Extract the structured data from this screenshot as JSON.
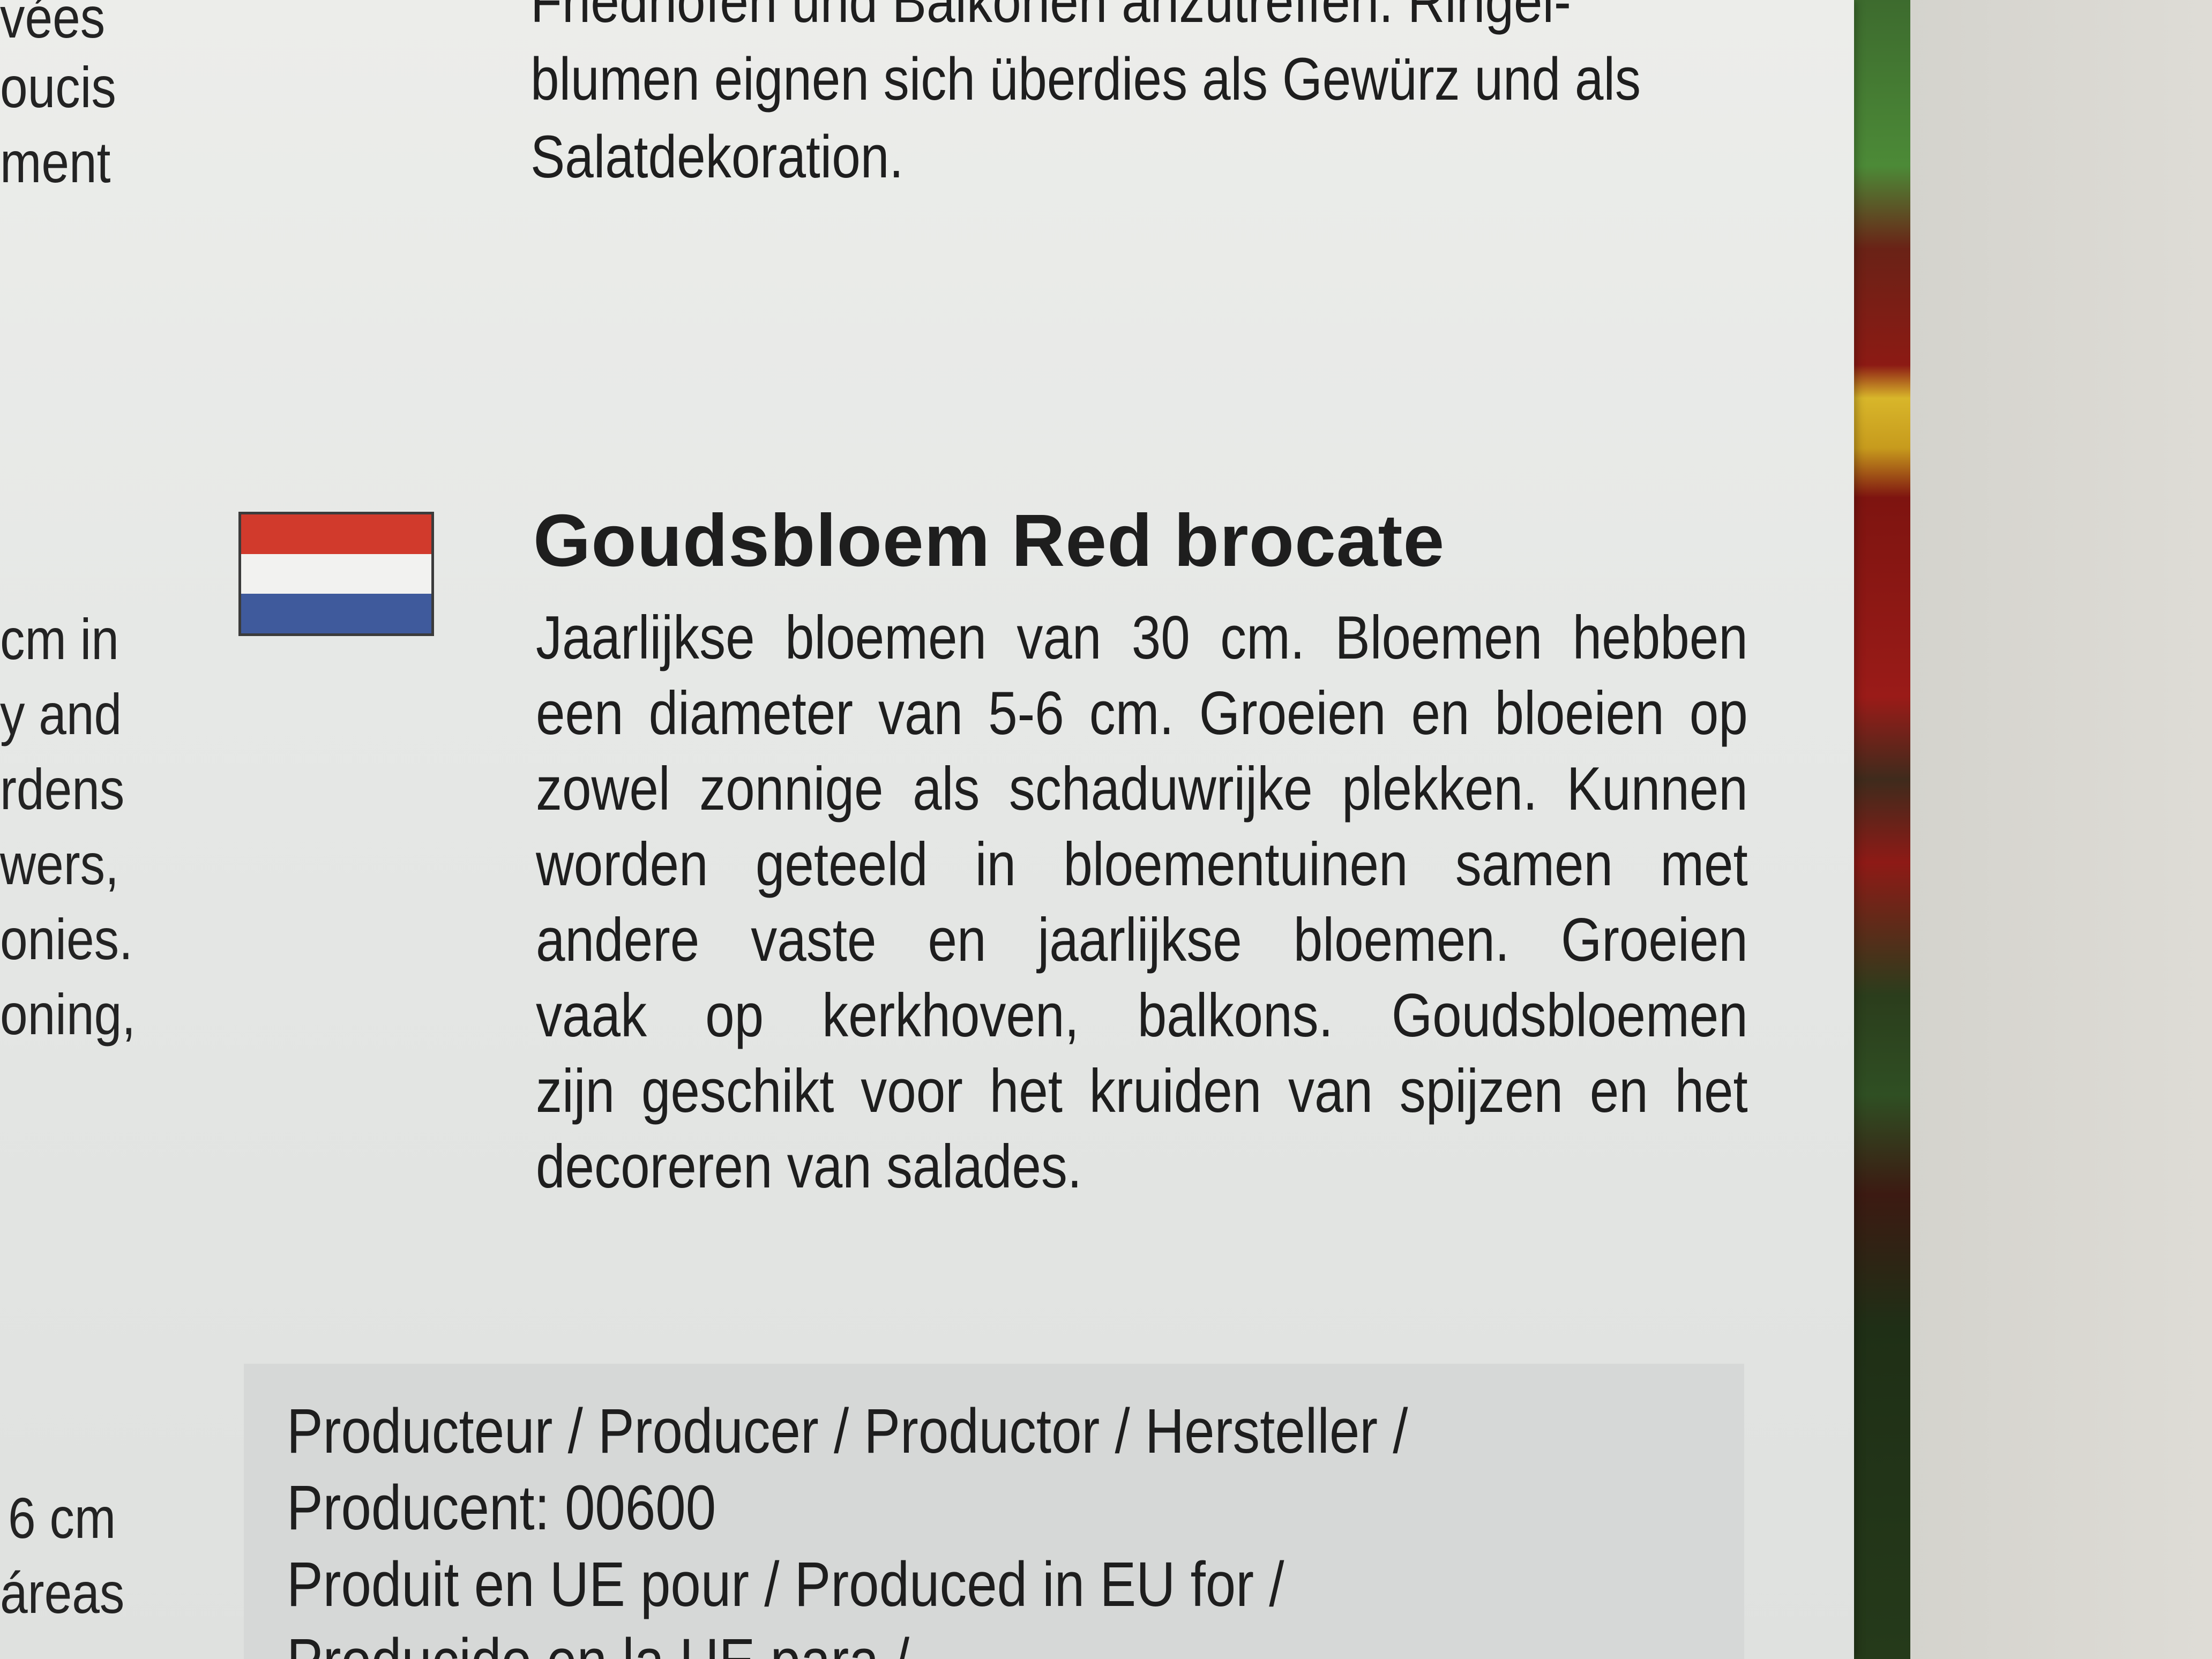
{
  "german": {
    "lines": [
      "Friedhöfen und Balkonen anzutreffen. Ringel-",
      "blumen eignen sich überdies als Gewürz und als",
      "Salatdekoration."
    ]
  },
  "left_fragments": {
    "top": [
      "vées",
      "oucis",
      "ment"
    ],
    "middle": [
      "cm in",
      "y and",
      "rdens",
      "wers,",
      "onies.",
      "oning,"
    ],
    "bottom": [
      "6 cm",
      "áreas"
    ]
  },
  "dutch": {
    "title": "Goudsbloem Red brocate",
    "lines": [
      "Jaarlijkse bloemen van 30 cm. Bloemen hebben",
      "een diameter van 5-6 cm. Groeien en bloeien op",
      "zowel zonnige als schaduwrijke plekken. Kunnen",
      "worden geteeld in bloementuinen samen met",
      "andere vaste en jaarlijkse bloemen. Groeien",
      "vaak op kerkhoven, balkons. Goudsbloemen",
      "zijn geschikt voor het kruiden van spijzen en het",
      "decoreren van salades."
    ]
  },
  "producer": {
    "lines": [
      "Producteur / Producer / Productor / Hersteller /",
      "Producent: 00600",
      "Produit en UE pour / Produced in EU for /",
      "Producido en la UE para /"
    ]
  },
  "colors": {
    "flag_red": "#d13a2c",
    "flag_white": "#f2f2f0",
    "flag_blue": "#3f5a9c",
    "paper": "#e8e9e6",
    "text": "#1e1e1e"
  }
}
